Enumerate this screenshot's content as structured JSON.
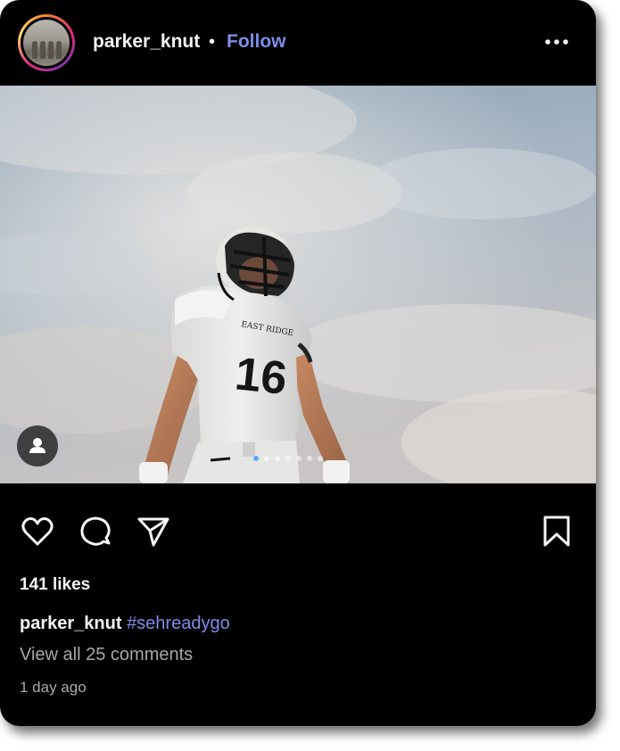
{
  "post": {
    "username": "parker_knut",
    "separator": "•",
    "follow_label": "Follow",
    "more_icon": "more-horizontal-icon",
    "photo": {
      "jersey_text": "EAST RIDGE",
      "jersey_number": "16",
      "carousel_count": 7,
      "carousel_active": 0
    },
    "actions": {
      "like_icon": "heart-icon",
      "comment_icon": "comment-icon",
      "share_icon": "send-icon",
      "save_icon": "bookmark-icon",
      "tag_icon": "user-tag-icon"
    },
    "likes": "141 likes",
    "caption": {
      "username": "parker_knut",
      "hashtag": "#sehreadygo"
    },
    "comments_link": "View all 25 comments",
    "timestamp": "1 day ago"
  },
  "colors": {
    "background": "#000000",
    "link_blue": "#7f8ce8",
    "text_primary": "#f5f5f5",
    "text_secondary": "#a8a8a8"
  }
}
